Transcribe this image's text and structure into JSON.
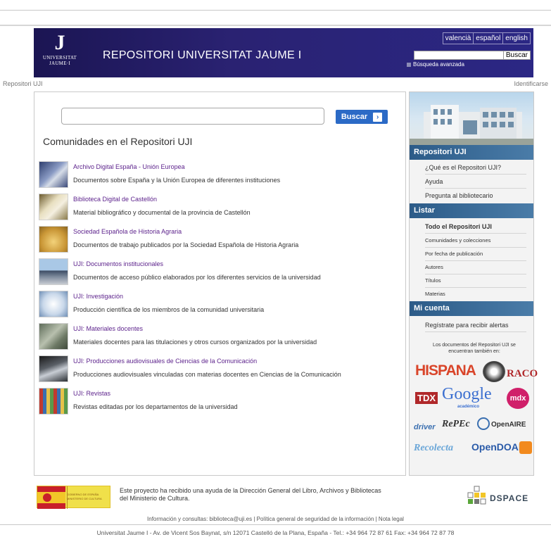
{
  "header": {
    "logo_mark": "J",
    "logo_line1": "UNIVERSITAT",
    "logo_line2": "JAUME·I",
    "site_title": "REPOSITORI UNIVERSITAT JAUME I",
    "languages": [
      "valencià",
      "español",
      "english"
    ],
    "search_button": "Buscar",
    "advanced_search": "Búsqueda avanzada"
  },
  "breadcrumb": "Repositori UJI",
  "login_link": "Identificarse",
  "main": {
    "search_button": "Buscar",
    "title": "Comunidades en el Repositori UJI",
    "communities": [
      {
        "name": "Archivo Digital España - Unión Europea",
        "desc": "Documentos sobre España y la Unión Europea de diferentes instituciones"
      },
      {
        "name": "Biblioteca Digital de Castellón",
        "desc": "Material bibliográfico y documental de la provincia de Castellón"
      },
      {
        "name": "Sociedad Española de Historia Agraria",
        "desc": "Documentos de trabajo publicados por la Sociedad Española de Historia Agraria"
      },
      {
        "name": "UJI: Documentos institucionales",
        "desc": "Documentos de acceso público elaborados por los diferentes servicios de la universidad"
      },
      {
        "name": "UJI: Investigación",
        "desc": "Producción científica de los miembros de la comunidad universitaria"
      },
      {
        "name": "UJI: Materiales docentes",
        "desc": "Materiales docentes para las titulaciones y otros cursos organizados por la universidad"
      },
      {
        "name": "UJI: Producciones audiovisuales de Ciencias de la Comunicación",
        "desc": "Producciones audiovisuales vinculadas con materias docentes en Ciencias de la Comunicación"
      },
      {
        "name": "UJI: Revistas",
        "desc": "Revistas editadas por los departamentos de la universidad"
      }
    ]
  },
  "sidebar": {
    "section1_title": "Repositori UJI",
    "section1_items": [
      "¿Qué es el Repositori UJI?",
      "Ayuda",
      "Pregunta al bibliotecario"
    ],
    "section2_title": "Listar",
    "section2_items": [
      "Todo el Repositori UJI",
      "Comunidades y colecciones",
      "Por fecha de publicación",
      "Autores",
      "Títulos",
      "Materias"
    ],
    "section3_title": "Mi cuenta",
    "section3_items": [
      "Regístrate para recibir alertas"
    ],
    "note": "Los documentos del Repositori UJI se encuentran también en:",
    "partner_logos": [
      "HISPANA",
      "RACO",
      "TDX",
      "Google",
      "académico",
      "mdx",
      "driver",
      "RePEc",
      "OpenAIRE",
      "Recolecta",
      "OpenDOAR"
    ]
  },
  "footer": {
    "gov_logo_text": "GOBIERNO DE ESPAÑA  MINISTERIO DE CULTURA",
    "project_text": "Este proyecto ha recibido una ayuda de la Dirección General del Libro, Archivos y Bibliotecas del Ministerio de Cultura.",
    "dspace": "DSPACE",
    "info_line": "Información y consultas: biblioteca@uji.es | Política general de seguridad de la información | Nota legal",
    "address": "Universitat Jaume I - Av. de Vicent Sos Baynat, s/n 12071 Castelló de la Plana, España - Tel.: +34 964 72 87 61 Fax: +34 964 72 87 78"
  },
  "colors": {
    "banner": "#2a2272",
    "link": "#5a1f8a",
    "sidebar_head": "#2c5b88",
    "button": "#2b6ac6"
  }
}
